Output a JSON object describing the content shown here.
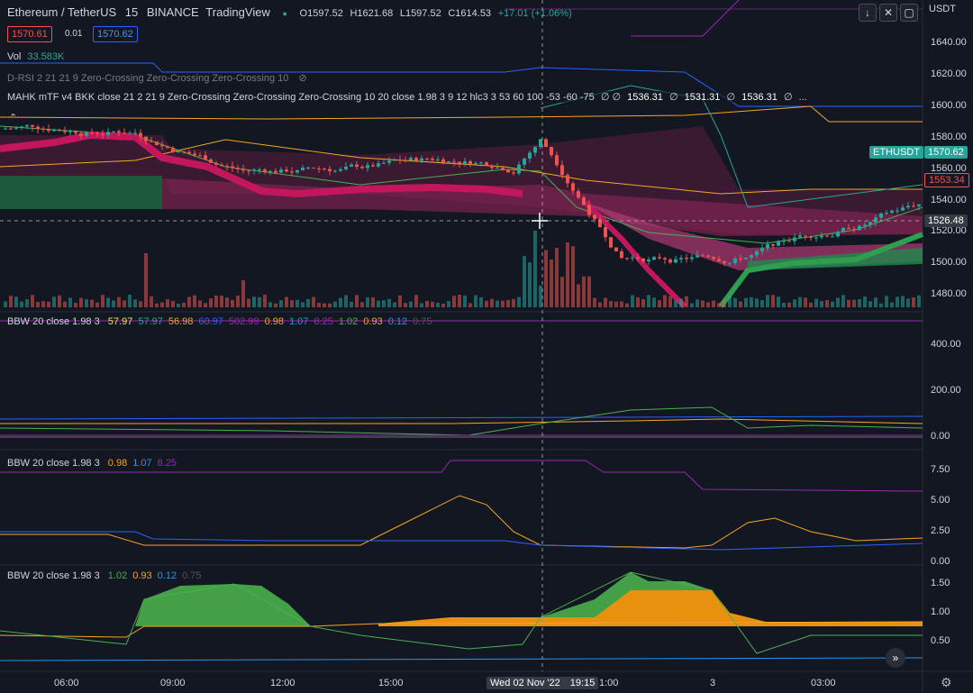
{
  "header": {
    "symbol": "Ethereum / TetherUS",
    "interval": "15",
    "exchange": "BINANCE",
    "platform": "TradingView",
    "ohlc": {
      "o": "O1597.52",
      "h": "H1621.68",
      "l": "L1597.52",
      "c": "C1614.53",
      "chg": "+17.01 (+1.06%)"
    },
    "bid": "1570.61",
    "spread": "0.01",
    "ask": "1570.62"
  },
  "indicators": {
    "vol": {
      "name": "Vol",
      "value": "33.583K"
    },
    "drsi": "D-RSI 2 21 21 9 Zero-Crossing Zero-Crossing Zero-Crossing 10",
    "mahk": {
      "text": "MAHK mTF v4 BKK close 21 2 21 9 Zero-Crossing Zero-Crossing Zero-Crossing 10 20 close 1.98 3 9 12 hlc3 3 53 60 100 -53 -60 -75",
      "v1": "∅",
      "v2": "∅",
      "v3": "1536.31",
      "v4": "∅",
      "v5": "1531.31",
      "v6": "∅",
      "v7": "1536.31",
      "v8": "∅",
      "dots": "..."
    }
  },
  "bbw1": {
    "name": "BBW 20 close 1.98 3",
    "vals": [
      "57.97",
      "57.97",
      "56.98",
      "60.97",
      "502.99",
      "0.98",
      "1.07",
      "8.25",
      "1.02",
      "0.93",
      "0.12",
      "0.75"
    ],
    "colors": [
      "#f7e04b",
      "#26a69a",
      "#f5a623",
      "#2962ff",
      "#9c27b0",
      "#f5a623",
      "#2196f3",
      "#9c27b0",
      "#4caf50",
      "#f5a623",
      "#2196f3",
      "#555"
    ]
  },
  "bbw2": {
    "name": "BBW 20 close 1.98 3",
    "vals": [
      "0.98",
      "1.07",
      "8.25"
    ],
    "colors": [
      "#f5a623",
      "#2196f3",
      "#9c27b0"
    ]
  },
  "bbw3": {
    "name": "BBW 20 close 1.98 3",
    "vals": [
      "1.02",
      "0.93",
      "0.12",
      "0.75"
    ],
    "colors": [
      "#4caf50",
      "#f5a623",
      "#2196f3",
      "#555"
    ]
  },
  "price_axis": {
    "currency": "USDT",
    "ticks": [
      "1640.00",
      "1620.00",
      "1600.00",
      "1580.00",
      "1560.00",
      "1540.00",
      "1520.00",
      "1500.00",
      "1480.00"
    ],
    "tags": {
      "symbol": "ETHUSDT",
      "last": "1570.62",
      "red": "1553.34",
      "cross": "1526.48"
    }
  },
  "bbw1_axis": [
    "400.00",
    "200.00",
    "0.00"
  ],
  "bbw2_axis": [
    "7.50",
    "5.00",
    "2.50",
    "0.00"
  ],
  "bbw3_axis": [
    "1.50",
    "1.00",
    "0.50"
  ],
  "time_axis": {
    "ticks": [
      "06:00",
      "09:00",
      "12:00",
      "15:00",
      "1:00",
      "3",
      "03:00"
    ],
    "crosshair": "Wed 02 Nov '22",
    "crosshair_time": "19:15"
  },
  "colors": {
    "up": "#26a69a",
    "down": "#ef5350",
    "bg": "#131722",
    "accent": "#2962ff"
  }
}
